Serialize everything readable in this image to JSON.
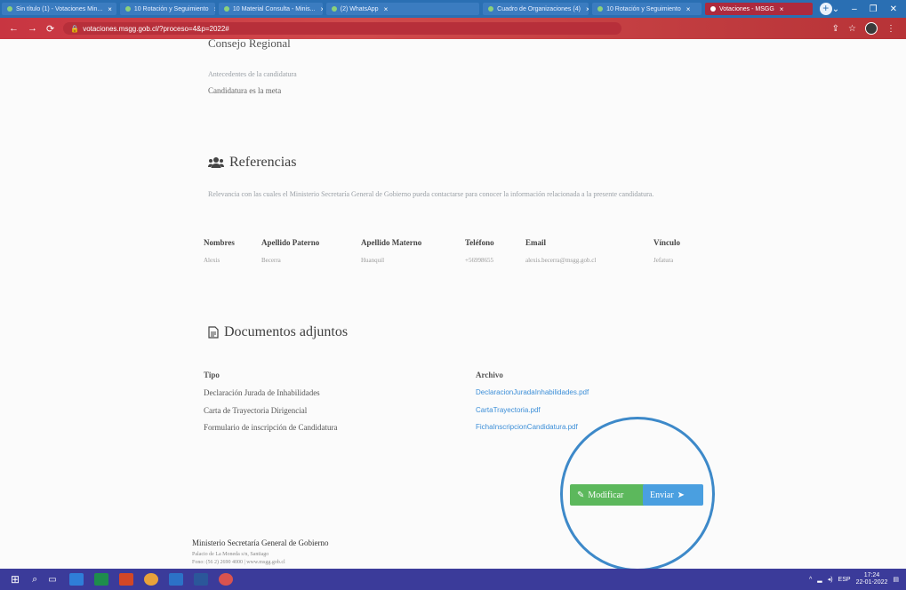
{
  "browser": {
    "tabs": [
      {
        "label": "Sin título (1) - Votaciones Min..."
      },
      {
        "label": "10 Rotación y Seguimiento"
      },
      {
        "label": "10 Material Consulta - Minis..."
      },
      {
        "label": "(2) WhatsApp"
      },
      {
        "label": "Cuadro de Organizaciones (4)"
      },
      {
        "label": "10 Rotación y Seguimiento"
      },
      {
        "label": "Votaciones - MSGG",
        "active": true
      }
    ],
    "url": "votaciones.msgg.gob.cl/?proceso=4&p=2022#"
  },
  "candidacy": {
    "partial_heading": "Consejo Regional",
    "note_faint": "Antecedentes de la candidatura",
    "note": "Candidatura es la meta"
  },
  "referencias": {
    "title": "Referencias",
    "description": "Relevancia con las cuales el Ministerio Secretaría General de Gobierno pueda contactarse para conocer la información relacionada a la presente candidatura.",
    "headers": [
      "Nombres",
      "Apellido Paterno",
      "Apellido Materno",
      "Teléfono",
      "Email",
      "Vínculo"
    ],
    "row": [
      "Alexis",
      "Becerra",
      "Huanquil",
      "+56998655",
      "alexis.becerra@msgg.gob.cl",
      "Jefatura"
    ]
  },
  "documentos": {
    "title": "Documentos adjuntos",
    "col_tipo": "Tipo",
    "col_archivo": "Archivo",
    "items": [
      {
        "tipo": "Declaración Jurada de Inhabilidades",
        "archivo": "DeclaracionJuradaInhabilidades.pdf"
      },
      {
        "tipo": "Carta de Trayectoria Dirigencial",
        "archivo": "CartaTrayectoria.pdf"
      },
      {
        "tipo": "Formulario de inscripción de Candidatura",
        "archivo": "FichaInscripcionCandidatura.pdf"
      }
    ]
  },
  "actions": {
    "modificar": "Modificar",
    "enviar": "Enviar"
  },
  "footer": {
    "title": "Ministerio Secretaría General de Gobierno",
    "address": "Palacio de La Moneda s/n, Santiago",
    "contact": "Fono: (56 2) 2690 4000 | www.msgg.gob.cl"
  },
  "taskbar": {
    "lang": "ESP",
    "time": "17:24",
    "date": "22-01-2022"
  }
}
